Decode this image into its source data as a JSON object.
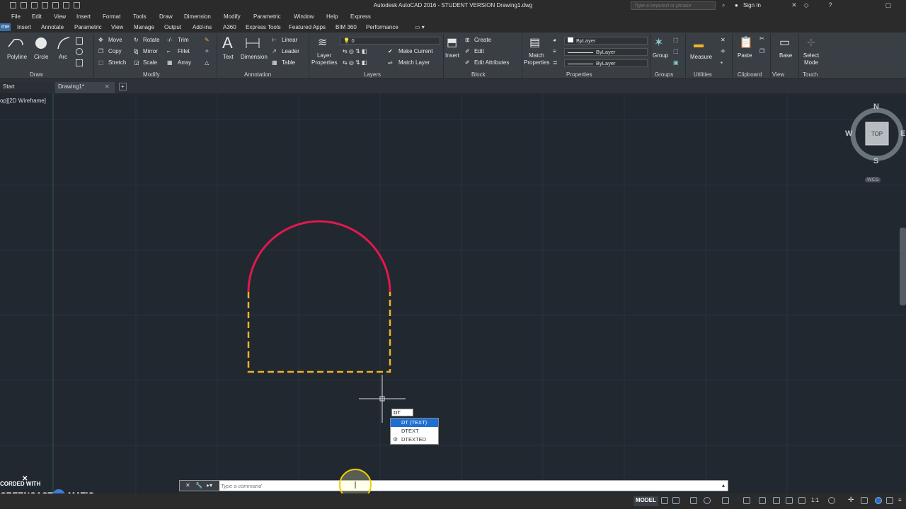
{
  "window": {
    "title": "Autodesk AutoCAD 2016 - STUDENT VERSION    Drawing1.dwg",
    "search_placeholder": "Type a keyword or phrase",
    "sign_in": "Sign In"
  },
  "menu": [
    "File",
    "Edit",
    "View",
    "Insert",
    "Format",
    "Tools",
    "Draw",
    "Dimension",
    "Modify",
    "Parametric",
    "Window",
    "Help",
    "Express"
  ],
  "ribbon_tabs": [
    "me",
    "Insert",
    "Annotate",
    "Parametric",
    "View",
    "Manage",
    "Output",
    "Add-ins",
    "A360",
    "Express Tools",
    "Featured Apps",
    "BIM 360",
    "Performance"
  ],
  "ribbon": {
    "draw": {
      "polyline": "Polyline",
      "circle": "Circle",
      "arc": "Arc",
      "panel": "Draw"
    },
    "modify": {
      "move": "Move",
      "rotate": "Rotate",
      "trim": "Trim",
      "copy": "Copy",
      "mirror": "Mirror",
      "fillet": "Fillet",
      "stretch": "Stretch",
      "scale": "Scale",
      "array": "Array",
      "panel": "Modify"
    },
    "annotation": {
      "text": "Text",
      "dimension": "Dimension",
      "linear": "Linear",
      "leader": "Leader",
      "table": "Table",
      "panel": "Annotation"
    },
    "layers": {
      "layer_properties": "Layer Properties",
      "layer_value": "0",
      "make_current": "Make Current",
      "match_layer": "Match Layer",
      "panel": "Layers"
    },
    "block": {
      "insert": "Insert",
      "create": "Create",
      "edit": "Edit",
      "edit_attributes": "Edit Attributes",
      "panel": "Block"
    },
    "properties": {
      "match_properties": "Match Properties",
      "color": "ByLayer",
      "linetype": "ByLayer",
      "lineweight": "ByLayer",
      "panel": "Properties"
    },
    "groups": {
      "group": "Group",
      "panel": "Groups"
    },
    "utilities": {
      "measure": "Measure",
      "panel": "Utilities"
    },
    "clipboard": {
      "paste": "Paste",
      "panel": "Clipboard"
    },
    "view": {
      "base": "Base",
      "panel": "View"
    },
    "touch": {
      "select_mode": "Select Mode",
      "panel": "Touch"
    }
  },
  "file_tabs": {
    "start": "Start",
    "drawing": "Drawing1*",
    "add": "+"
  },
  "viewport_label": "op][2D Wireframe]",
  "viewcube": {
    "n": "N",
    "s": "S",
    "w": "W",
    "e": "E",
    "face": "TOP",
    "wcs": "WCS"
  },
  "autocomplete": {
    "typed": "DT",
    "items": [
      "DT (TEXT)",
      "DTEXT",
      "DTEXTED"
    ],
    "selected_index": 0
  },
  "command_line": {
    "placeholder": "Type a command"
  },
  "status": {
    "model": "MODEL",
    "scale": "1:1"
  },
  "watermark": {
    "line1": "CORDED WITH",
    "line2": "CREENCAST",
    "line3": "MATIC"
  },
  "colors": {
    "arc": "#e0194d",
    "dashed": "#f0b428",
    "background": "#212830",
    "accent": "#1f6fd1"
  }
}
